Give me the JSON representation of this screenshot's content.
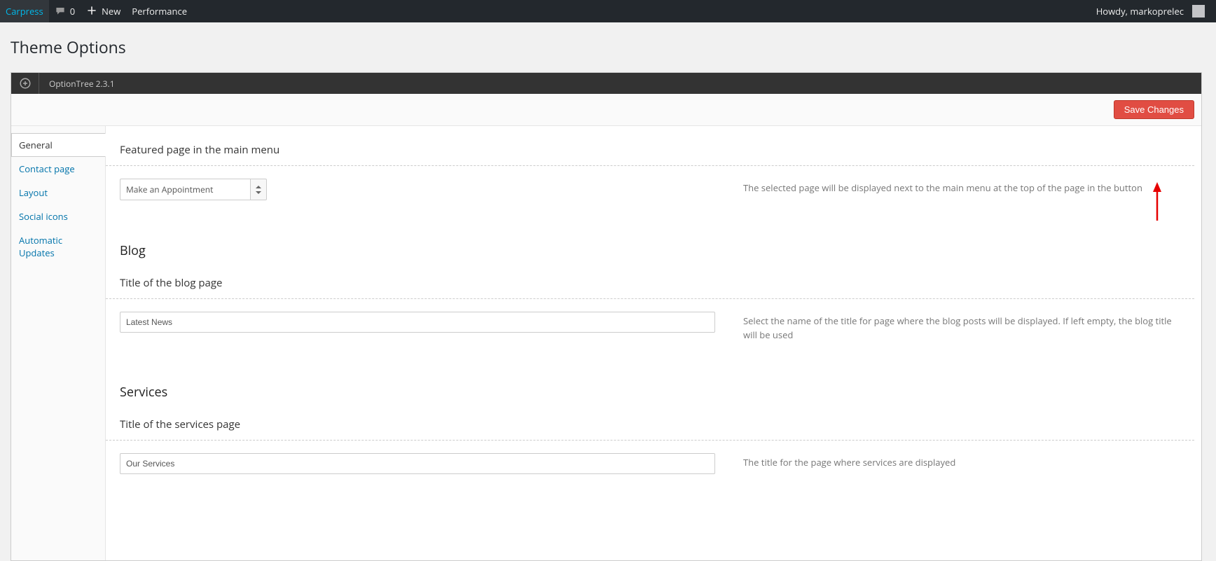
{
  "admin_bar": {
    "site_name": "Carpress",
    "comments_count": "0",
    "new_label": "New",
    "performance_label": "Performance",
    "howdy": "Howdy, markoprelec"
  },
  "page_title": "Theme Options",
  "option_tree": {
    "version": "OptionTree 2.3.1",
    "save_button": "Save Changes"
  },
  "sidebar": {
    "tabs": [
      {
        "label": "General",
        "active": true
      },
      {
        "label": "Contact page",
        "active": false
      },
      {
        "label": "Layout",
        "active": false
      },
      {
        "label": "Social icons",
        "active": false
      },
      {
        "label": "Automatic Updates",
        "active": false
      }
    ]
  },
  "settings": {
    "featured_page": {
      "title": "Featured page in the main menu",
      "value": "Make an Appointment",
      "desc": "The selected page will be displayed next to the main menu at the top of the page in the button"
    },
    "blog_section": "Blog",
    "blog_title": {
      "title": "Title of the blog page",
      "value": "Latest News",
      "desc": "Select the name of the title for page where the blog posts will be displayed. If left empty, the blog title will be used"
    },
    "services_section": "Services",
    "services_title": {
      "title": "Title of the services page",
      "value": "Our Services",
      "desc": "The title for the page where services are displayed"
    }
  }
}
